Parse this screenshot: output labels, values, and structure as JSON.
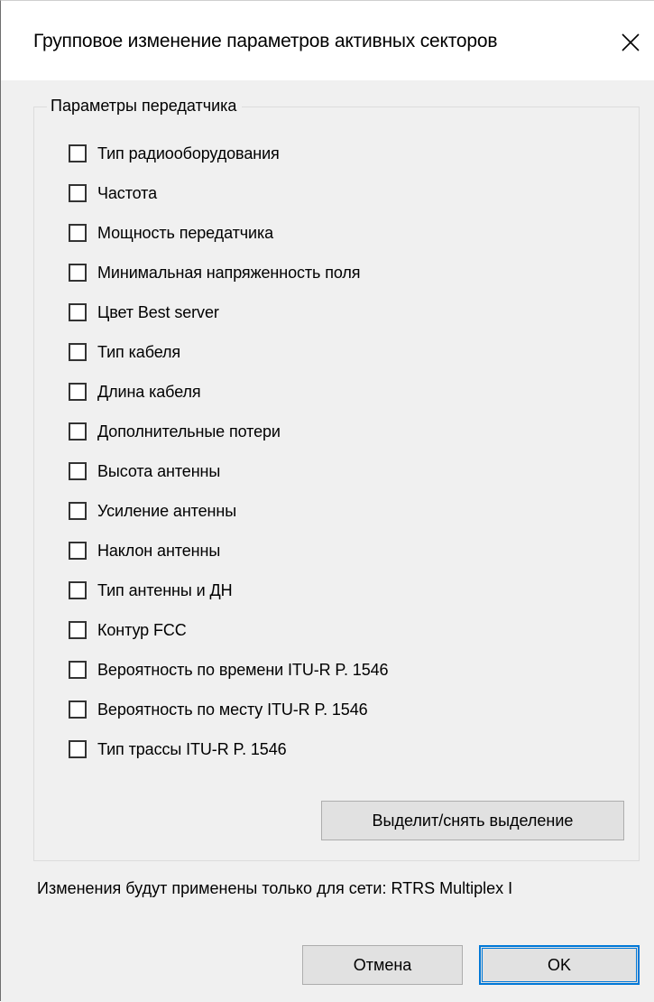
{
  "dialog": {
    "title": "Групповое изменение параметров активных секторов",
    "close_icon": "close-icon"
  },
  "transmitter_group": {
    "legend": "Параметры передатчика",
    "checkboxes": [
      {
        "label": "Тип радиооборудования",
        "checked": false
      },
      {
        "label": "Частота",
        "checked": false
      },
      {
        "label": "Мощность передатчика",
        "checked": false
      },
      {
        "label": "Минимальная напряженность поля",
        "checked": false
      },
      {
        "label": "Цвет Best server",
        "checked": false
      },
      {
        "label": "Тип кабеля",
        "checked": false
      },
      {
        "label": "Длина кабеля",
        "checked": false
      },
      {
        "label": "Дополнительные потери",
        "checked": false
      },
      {
        "label": "Высота антенны",
        "checked": false
      },
      {
        "label": "Усиление антенны",
        "checked": false
      },
      {
        "label": "Наклон антенны",
        "checked": false
      },
      {
        "label": "Тип антенны и ДН",
        "checked": false
      },
      {
        "label": "Контур FCC",
        "checked": false
      },
      {
        "label": "Вероятность по времени ITU-R P. 1546",
        "checked": false
      },
      {
        "label": "Вероятность по месту ITU-R P. 1546",
        "checked": false
      },
      {
        "label": "Тип трассы ITU-R P. 1546",
        "checked": false
      }
    ],
    "toggle_all_button": "Выделит/снять выделение"
  },
  "network_note": "Изменения будут применены только для сети: RTRS Multiplex I",
  "footer": {
    "cancel_label": "Отмена",
    "ok_label": "OK"
  },
  "colors": {
    "dialog_bg": "#f0f0f0",
    "title_bg": "#ffffff",
    "button_bg": "#e1e1e1",
    "default_button_border": "#0078d7"
  }
}
